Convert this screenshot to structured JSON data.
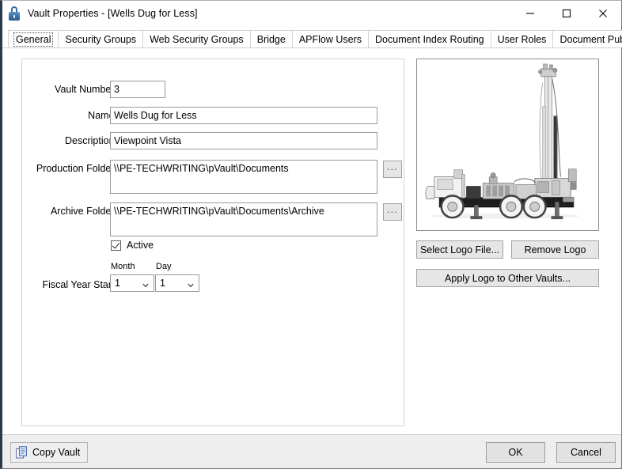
{
  "window": {
    "title": "Vault Properties - [Wells Dug for Less]",
    "icon": "lock-icon",
    "minimize_label": "Minimize",
    "maximize_label": "Maximize",
    "close_label": "Close"
  },
  "tabs": [
    {
      "label": "General",
      "active": true
    },
    {
      "label": "Security Groups",
      "active": false
    },
    {
      "label": "Web Security Groups",
      "active": false
    },
    {
      "label": "Bridge",
      "active": false
    },
    {
      "label": "APFlow Users",
      "active": false
    },
    {
      "label": "Document Index Routing",
      "active": false
    },
    {
      "label": "User Roles",
      "active": false
    },
    {
      "label": "Document Publishing",
      "active": false
    }
  ],
  "general": {
    "vault_number": {
      "label": "Vault Number:",
      "value": "3"
    },
    "name": {
      "label": "Name:",
      "value": "Wells Dug for Less"
    },
    "description": {
      "label": "Description:",
      "value": "Viewpoint Vista"
    },
    "production_folder": {
      "label": "Production Folder:",
      "value": "\\\\PE-TECHWRITING\\pVault\\Documents",
      "browse_label": "..."
    },
    "archive_folder": {
      "label": "Archive Folder:",
      "value": "\\\\PE-TECHWRITING\\pVault\\Documents\\Archive",
      "browse_label": "..."
    },
    "active": {
      "label": "Active",
      "checked": true
    },
    "fiscal_year_start": {
      "label": "Fiscal Year Start:",
      "month_label": "Month",
      "month_value": "1",
      "day_label": "Day",
      "day_value": "1"
    }
  },
  "logo": {
    "alt": "water-well drilling rig truck",
    "select_label": "Select Logo File...",
    "remove_label": "Remove Logo",
    "apply_label": "Apply Logo to Other Vaults..."
  },
  "footer": {
    "copy_vault_label": "Copy Vault",
    "copy_vault_icon": "copy-documents-icon",
    "ok_label": "OK",
    "cancel_label": "Cancel"
  },
  "colors": {
    "accent": "#3b6ea5",
    "window_edge": "#2b3a4a",
    "button_face": "#e6e6e6",
    "panel_border": "#d4d4d4"
  }
}
